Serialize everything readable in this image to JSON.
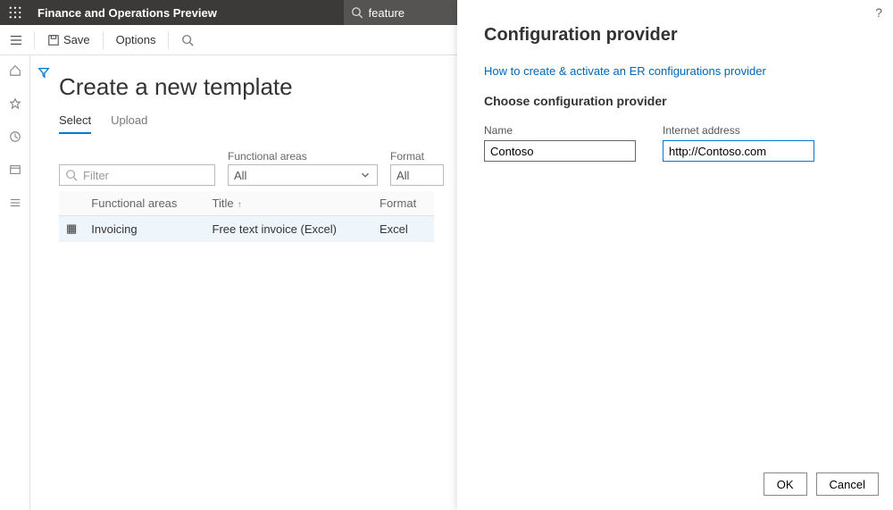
{
  "topbar": {
    "title": "Finance and Operations Preview",
    "search_value": "feature"
  },
  "actionbar": {
    "save_label": "Save",
    "options_label": "Options"
  },
  "page": {
    "heading": "Create a new template",
    "tabs": [
      "Select",
      "Upload"
    ],
    "active_tab": 0,
    "filter_placeholder": "Filter",
    "functional_label": "Functional areas",
    "functional_value": "All",
    "format_label": "Format",
    "format_value": "All",
    "columns": {
      "c1": "Functional areas",
      "c2": "Title",
      "c3": "Format"
    },
    "rows": [
      {
        "functional": "Invoicing",
        "title": "Free text invoice (Excel)",
        "format": "Excel"
      }
    ]
  },
  "panel": {
    "title": "Configuration provider",
    "link_text": "How to create & activate an ER configurations provider",
    "subhead": "Choose configuration provider",
    "name_label": "Name",
    "name_value": "Contoso",
    "addr_label": "Internet address",
    "addr_value": "http://Contoso.com",
    "ok_label": "OK",
    "cancel_label": "Cancel"
  }
}
